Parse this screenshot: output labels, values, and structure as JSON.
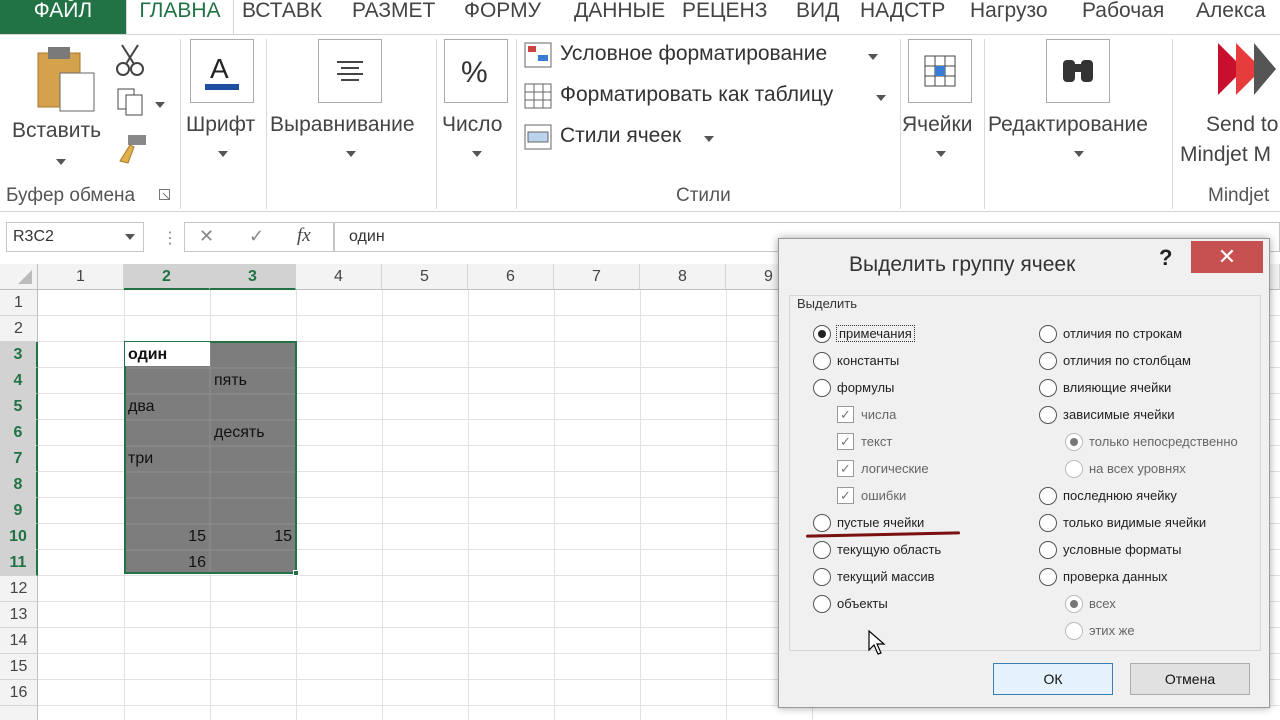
{
  "ribbon_tabs": [
    "ФАЙЛ",
    "ГЛАВНА",
    "ВСТАВК",
    "РАЗМЕТ",
    "ФОРМУ",
    "ДАННЫЕ",
    "РЕЦЕНЗ",
    "ВИД",
    "НАДСТР",
    "Нагрузо",
    "Рабочая",
    "Алекса"
  ],
  "ribbon": {
    "paste_label": "Вставить",
    "clipboard_group": "Буфер обмена",
    "font_label": "Шрифт",
    "alignment_label": "Выравнивание",
    "number_label": "Число",
    "styles": {
      "conditional": "Условное форматирование",
      "format_table": "Форматировать как таблицу",
      "cell_styles": "Стили ячеек",
      "group": "Стили"
    },
    "cells_label": "Ячейки",
    "editing_label": "Редактирование",
    "mindjet_line1": "Send to",
    "mindjet_line2": "Mindjet M",
    "mindjet_group": "Mindjet"
  },
  "formula_bar": {
    "name_box": "R3C2",
    "fx": "fx",
    "cancel": "✕",
    "enter": "✓",
    "value": "один"
  },
  "grid": {
    "columns": [
      "1",
      "2",
      "3",
      "4",
      "5",
      "6",
      "7",
      "8",
      "9"
    ],
    "rows": [
      "1",
      "2",
      "3",
      "4",
      "5",
      "6",
      "7",
      "8",
      "9",
      "10",
      "11",
      "12",
      "13",
      "14",
      "15",
      "16"
    ],
    "cells": {
      "r3c2": "один",
      "r4c3": "пять",
      "r5c2": "два",
      "r6c3": "десять",
      "r7c2": "три",
      "r10c2": "15",
      "r10c3": "15",
      "r11c2": "16"
    }
  },
  "dialog": {
    "title": "Выделить группу ячеек",
    "help": "?",
    "close": "✕",
    "section": "Выделить",
    "left": {
      "comments": "примечания",
      "constants": "константы",
      "formulas": "формулы",
      "numbers": "числа",
      "text": "текст",
      "logical": "логические",
      "errors": "ошибки",
      "blanks": "пустые ячейки",
      "current_region": "текущую область",
      "current_array": "текущий массив",
      "objects": "объекты"
    },
    "right": {
      "row_diff": "отличия по строкам",
      "col_diff": "отличия по столбцам",
      "precedents": "влияющие ячейки",
      "dependents": "зависимые ячейки",
      "direct_only": "только непосредственно",
      "all_levels": "на всех уровнях",
      "last_cell": "последнюю ячейку",
      "visible_only": "только видимые ячейки",
      "conditional_formats": "условные форматы",
      "data_validation": "проверка данных",
      "all": "всех",
      "same": "этих же"
    },
    "ok": "ОК",
    "cancel": "Отмена"
  },
  "colors": {
    "excel_green": "#217346",
    "selection_fill": "#7d7d7d",
    "close_red": "#c75050"
  }
}
